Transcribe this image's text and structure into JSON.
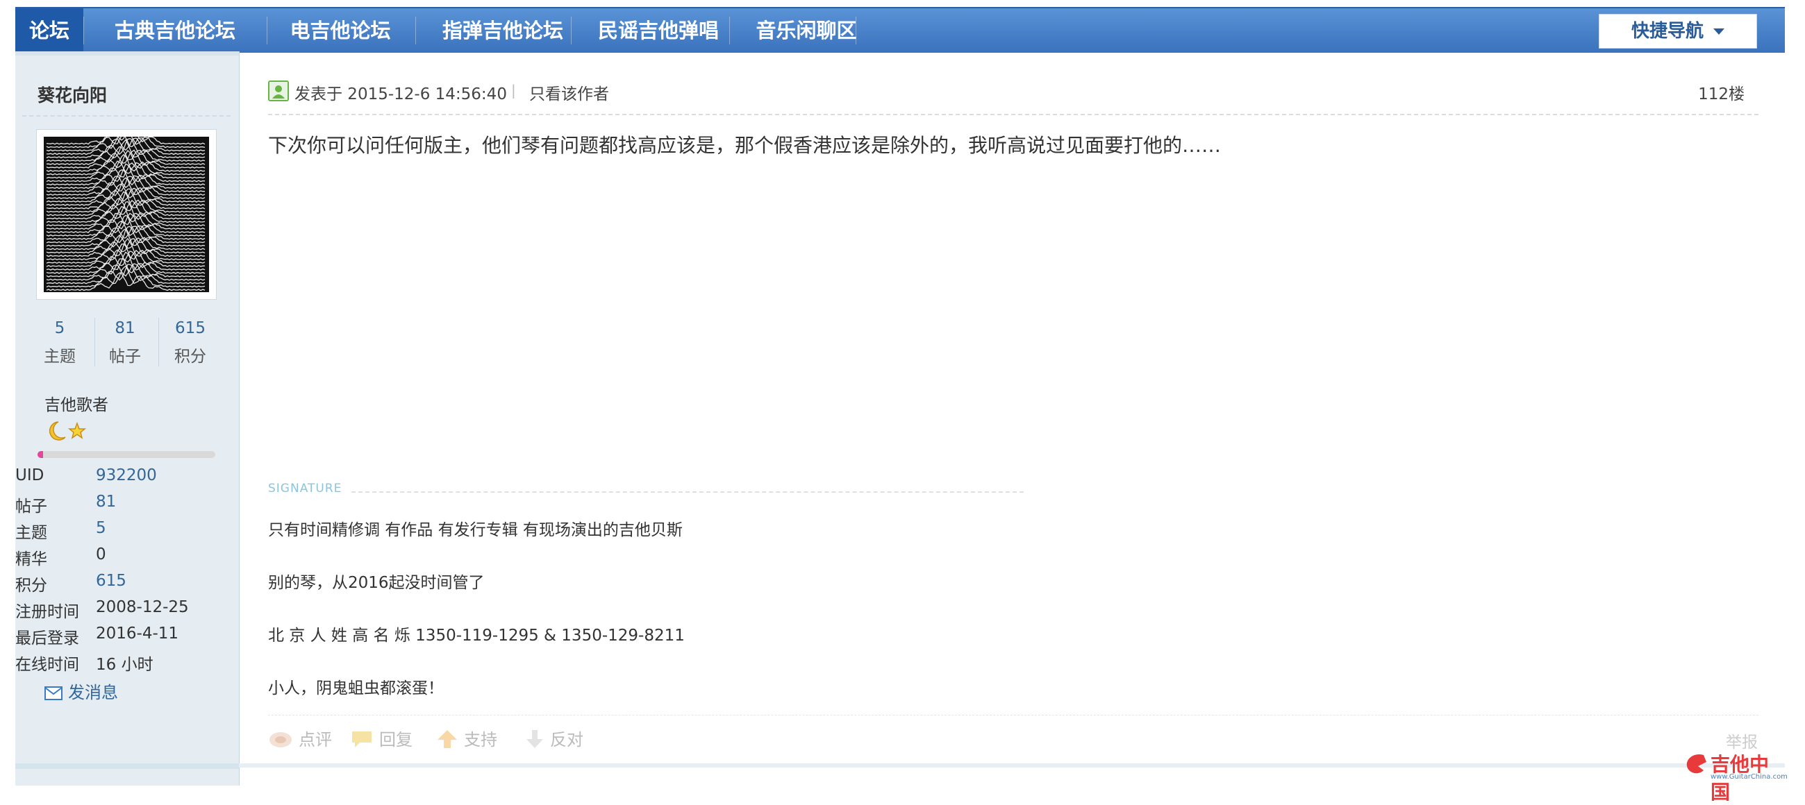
{
  "nav": {
    "items": [
      "论坛",
      "古典吉他论坛",
      "电吉他论坛",
      "指弹吉他论坛",
      "民谣吉他弹唱",
      "音乐闲聊区"
    ],
    "quick_nav": "快捷导航",
    "colors": {
      "bar": "#3a72bd",
      "active": "#1f5aa8",
      "text": "#ffffff"
    }
  },
  "user": {
    "name": "葵花向阳",
    "stats": [
      {
        "value": "5",
        "label": "主题"
      },
      {
        "value": "81",
        "label": "帖子"
      },
      {
        "value": "615",
        "label": "积分"
      }
    ],
    "group": "吉他歌者",
    "level_icons": [
      "moon-icon",
      "star-icon"
    ],
    "level_progress": 0.03,
    "info": [
      {
        "key": "UID",
        "value": "932200"
      },
      {
        "key": "帖子",
        "value": "81"
      },
      {
        "key": "主题",
        "value": "5"
      },
      {
        "key": "精华",
        "value": "0"
      },
      {
        "key": "积分",
        "value": "615"
      },
      {
        "key": "注册时间",
        "value": "2008-12-25"
      },
      {
        "key": "最后登录",
        "value": "2016-4-11"
      },
      {
        "key": "在线时间",
        "value": "16 小时"
      }
    ],
    "send_message": "发消息"
  },
  "post": {
    "posted_at": "发表于 2015-12-6 14:56:40",
    "author_only": "只看该作者",
    "floor": "112楼",
    "body": "下次你可以问任何版主，他们琴有问题都找高应该是，那个假香港应该是除外的，我听高说过见面要打他的……"
  },
  "signature": {
    "title": "SIGNATURE",
    "lines": [
      "只有时间精修调   有作品   有发行专辑   有现场演出的吉他贝斯",
      "别的琴，从2016起没时间管了",
      "北 京 人 姓 高 名 烁    1350-119-1295  &  1350-129-8211",
      "小人，阴鬼蛆虫都滚蛋！"
    ]
  },
  "actions": {
    "rate": "点评",
    "reply": "回复",
    "support": "支持",
    "oppose": "反对",
    "report": "举报"
  },
  "watermark": {
    "text": "吉他中国",
    "sub": "www.GuitarChina.com"
  }
}
